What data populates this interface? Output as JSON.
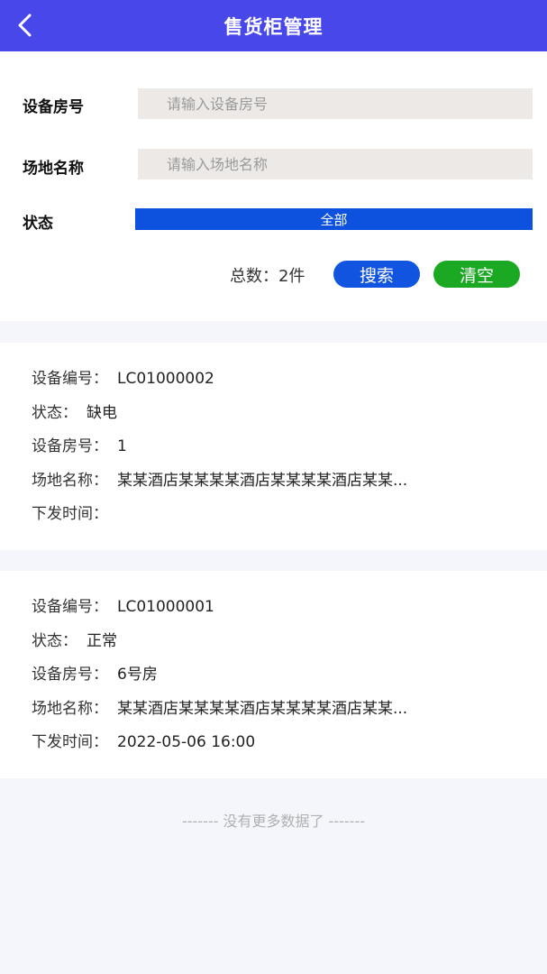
{
  "header": {
    "title": "售货柜管理",
    "back_icon": "chevron-left-icon"
  },
  "filters": {
    "room": {
      "label": "设备房号",
      "placeholder": "请输入设备房号",
      "value": ""
    },
    "venue": {
      "label": "场地名称",
      "placeholder": "请输入场地名称",
      "value": ""
    },
    "status": {
      "label": "状态",
      "selected": "全部"
    },
    "total_text": "总数：2件",
    "search_label": "搜索",
    "clear_label": "清空"
  },
  "labels": {
    "device_no": "设备编号：",
    "status": "状态：",
    "room_no": "设备房号：",
    "venue": "场地名称：",
    "issue_time": "下发时间："
  },
  "records": [
    {
      "device_no": "LC01000002",
      "status": "缺电",
      "room_no": "1",
      "venue": "某某酒店某某某某酒店某某某某酒店某某...",
      "issue_time": ""
    },
    {
      "device_no": "LC01000001",
      "status": "正常",
      "room_no": "6号房",
      "venue": "某某酒店某某某某酒店某某某某酒店某某...",
      "issue_time": "2022-05-06 16:00"
    }
  ],
  "footer": {
    "no_more": "-------  没有更多数据了  -------"
  },
  "colors": {
    "header": "#4848ea",
    "status_select": "#0d52de",
    "search": "#1054e0",
    "clear": "#1ba823"
  }
}
